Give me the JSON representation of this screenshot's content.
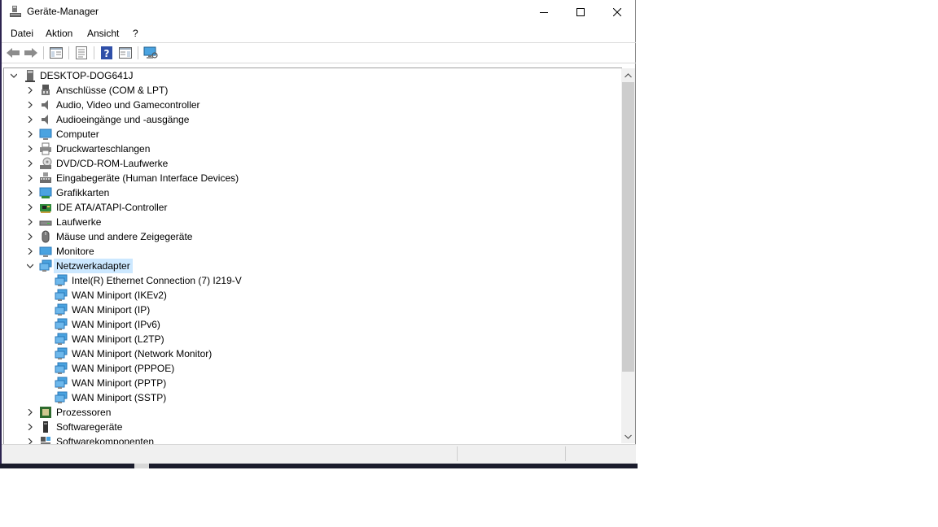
{
  "window": {
    "title": "Geräte-Manager",
    "controls": {
      "minimize": "minimize-icon",
      "maximize": "maximize-icon",
      "close": "close-icon"
    }
  },
  "menu": [
    "Datei",
    "Aktion",
    "Ansicht",
    "?"
  ],
  "toolbar": {
    "buttons": [
      "back-arrow-icon",
      "forward-arrow-icon",
      "show-hide-console-tree-icon",
      "properties-icon",
      "help-icon",
      "action-pane-icon",
      "scan-hardware-icon"
    ]
  },
  "tree": {
    "root": "DESKTOP-DOG641J",
    "categories": [
      {
        "label": "Anschlüsse (COM & LPT)",
        "icon": "port-icon"
      },
      {
        "label": "Audio, Video und Gamecontroller",
        "icon": "speaker-icon"
      },
      {
        "label": "Audioeingänge und -ausgänge",
        "icon": "speaker-icon"
      },
      {
        "label": "Computer",
        "icon": "monitor-icon"
      },
      {
        "label": "Druckwarteschlangen",
        "icon": "printer-icon"
      },
      {
        "label": "DVD/CD-ROM-Laufwerke",
        "icon": "dvd-drive-icon"
      },
      {
        "label": "Eingabegeräte (Human Interface Devices)",
        "icon": "keyboard-icon"
      },
      {
        "label": "Grafikkarten",
        "icon": "display-adapter-icon"
      },
      {
        "label": "IDE ATA/ATAPI-Controller",
        "icon": "controller-card-icon"
      },
      {
        "label": "Laufwerke",
        "icon": "disk-drive-icon"
      },
      {
        "label": "Mäuse und andere Zeigegeräte",
        "icon": "mouse-icon"
      },
      {
        "label": "Monitore",
        "icon": "monitor-icon"
      },
      {
        "label": "Netzwerkadapter",
        "icon": "network-adapter-icon",
        "expanded": true,
        "selected": true
      }
    ],
    "network_adapters": [
      "Intel(R) Ethernet Connection (7) I219-V",
      "WAN Miniport (IKEv2)",
      "WAN Miniport (IP)",
      "WAN Miniport (IPv6)",
      "WAN Miniport (L2TP)",
      "WAN Miniport (Network Monitor)",
      "WAN Miniport (PPPOE)",
      "WAN Miniport (PPTP)",
      "WAN Miniport (SSTP)"
    ],
    "after": [
      {
        "label": "Prozessoren",
        "icon": "processor-icon"
      },
      {
        "label": "Softwaregeräte",
        "icon": "software-device-icon"
      },
      {
        "label": "Softwarekomponenten",
        "icon": "software-component-icon"
      }
    ]
  },
  "colors": {
    "selection": "#cce8ff",
    "icon_blue": "#3a8fd6",
    "scroll_thumb": "#cdcdcd"
  }
}
